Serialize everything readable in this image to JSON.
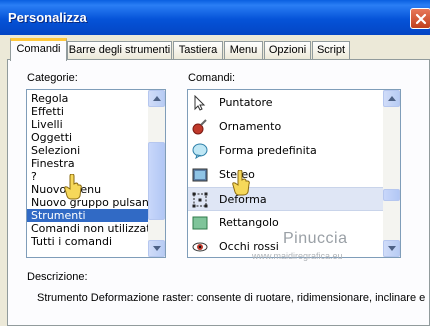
{
  "window": {
    "title": "Personalizza"
  },
  "tabs": [
    {
      "label": "Comandi",
      "active": true
    },
    {
      "label": "Barre degli strumenti",
      "active": false
    },
    {
      "label": "Tastiera",
      "active": false
    },
    {
      "label": "Menu",
      "active": false
    },
    {
      "label": "Opzioni",
      "active": false
    },
    {
      "label": "Script",
      "active": false
    }
  ],
  "categories": {
    "label": "Categorie:",
    "items": [
      "Regola",
      "Effetti",
      "Livelli",
      "Oggetti",
      "Selezioni",
      "Finestra",
      "?",
      "Nuovo menu",
      "Nuovo gruppo pulsanti",
      "Strumenti",
      "Comandi non utilizzati",
      "Tutti i comandi"
    ],
    "selected": "Strumenti"
  },
  "commands": {
    "label": "Comandi:",
    "items": [
      {
        "label": "Puntatore",
        "icon": "pointer-icon"
      },
      {
        "label": "Ornamento",
        "icon": "ornament-icon"
      },
      {
        "label": "Forma predefinita",
        "icon": "preset-shape-icon"
      },
      {
        "label": "Stereo",
        "icon": "stereo-icon"
      },
      {
        "label": "Deforma",
        "icon": "deform-icon"
      },
      {
        "label": "Rettangolo",
        "icon": "rectangle-icon"
      },
      {
        "label": "Occhi rossi",
        "icon": "red-eye-icon"
      }
    ],
    "selected": "Deforma"
  },
  "description": {
    "label": "Descrizione:",
    "text": "Strumento Deformazione raster: consente di ruotare, ridimensionare, inclinare e"
  },
  "watermark": {
    "name": "Pinuccia",
    "site": "www.maidiregrafica.eu"
  }
}
